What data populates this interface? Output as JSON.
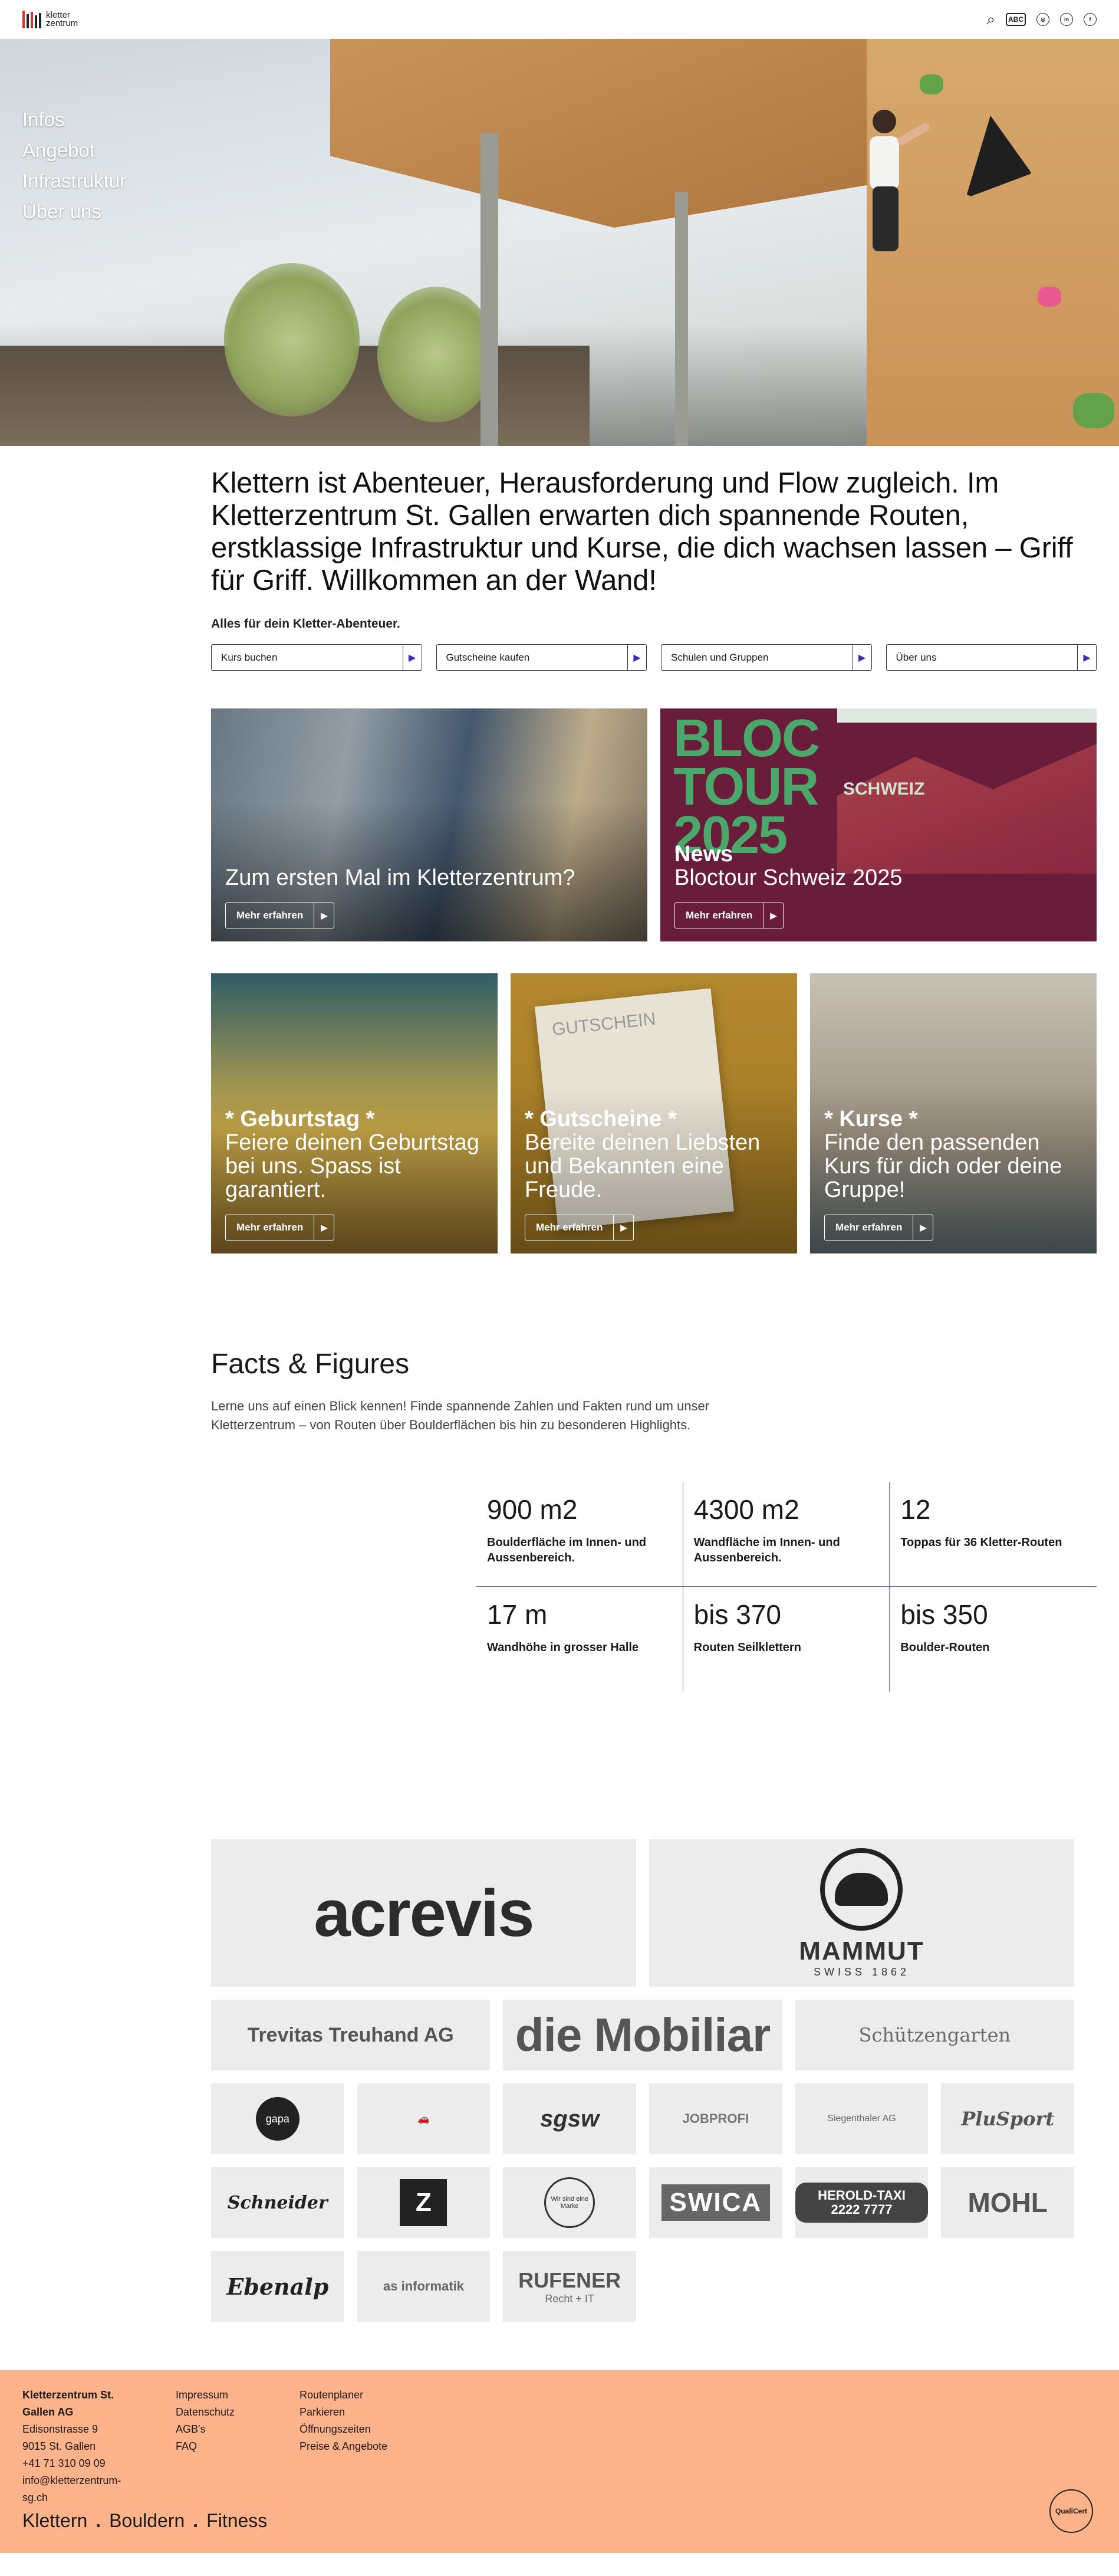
{
  "header": {
    "logo_line1": "kletter",
    "logo_line2": "zentrum",
    "accessibility_label": "ABC",
    "social": [
      "instagram-icon",
      "linkedin-icon",
      "facebook-icon"
    ]
  },
  "hero_nav": [
    "Infos",
    "Angebot",
    "Infrastruktur",
    "Über uns"
  ],
  "intro": {
    "headline": "Klettern ist Abenteuer, Herausforderung und Flow zugleich. Im Kletterzentrum St. Gallen erwarten dich spannende Routen, erstklassige Infrastruktur und Kurse, die dich wachsen lassen – Griff für Griff. Willkommen an der Wand!",
    "subtitle": "Alles für dein Kletter-Abenteuer.",
    "buttons": [
      "Kurs buchen",
      "Gutscheine kaufen",
      "Schulen und Gruppen",
      "Über uns"
    ]
  },
  "teasers_top": [
    {
      "kicker": "",
      "title": "Zum ersten Mal im Kletterzentrum?",
      "button": "Mehr erfahren"
    },
    {
      "kicker": "News",
      "title": "Bloctour Schweiz 2025",
      "button": "Mehr erfahren",
      "bg_text": "BLOC TOUR 2025",
      "bg_sub": "SCHWEIZ"
    }
  ],
  "teasers_bottom": [
    {
      "kicker": "* Geburtstag *",
      "text": "Feiere deinen Geburtstag bei uns. Spass ist garantiert.",
      "button": "Mehr erfahren"
    },
    {
      "kicker": "* Gutscheine *",
      "text": "Bereite deinen Liebsten und Bekannten eine Freude.",
      "button": "Mehr erfahren",
      "bg_text": "GUTSCHEIN"
    },
    {
      "kicker": "* Kurse *",
      "text": "Finde den passenden Kurs für dich oder deine Gruppe!",
      "button": "Mehr erfahren"
    }
  ],
  "facts": {
    "title": "Facts & Figures",
    "intro": "Lerne uns auf einen Blick kennen! Finde spannende Zahlen und Fakten rund um unser Kletterzentrum – von Routen über Boulderflächen bis hin zu besonderen Highlights.",
    "items": [
      {
        "value": "900 m2",
        "label": "Boulderfläche im Innen- und Aussenbereich."
      },
      {
        "value": "4300 m2",
        "label": "Wandfläche im Innen- und Aussenbereich."
      },
      {
        "value": "12",
        "label": "Toppas für 36 Kletter-Routen"
      },
      {
        "value": "17 m",
        "label": "Wandhöhe in grosser Halle"
      },
      {
        "value": "bis 370",
        "label": "Routen Seilklettern"
      },
      {
        "value": "bis 350",
        "label": "Boulder-Routen"
      }
    ]
  },
  "sponsors": {
    "acrevis": "acrevis",
    "mammut": "MAMMUT",
    "mammut_sub": "SWISS 1862",
    "trevitas": "Trevitas Treuhand AG",
    "mobiliar": "die Mobiliar",
    "schuetzengarten": "Schützengarten",
    "gapa": "gapa",
    "swica": "SWICA",
    "sgsw": "sgsw",
    "jobprofi": "JOBPROFI",
    "siegenthaler": "Siegenthaler AG",
    "plusport": "PluSport",
    "schneider": "Schneider",
    "z_logo": "Z",
    "taxi": "HEROLD-TAXI 2222 7777",
    "mohl": "MOHL",
    "ebenalp": "Ebenalp",
    "asinformatik": "as informatik",
    "rufener": "RUFENER",
    "rufener_sub": "Recht + IT",
    "seal_text": "Wir sind eine Marke"
  },
  "footer": {
    "company": "Kletterzentrum St. Gallen AG",
    "street": "Edisonstrasse 9",
    "city": "9015 St. Gallen",
    "phone": "+41 71 310 09 09",
    "email": "info@kletterzentrum-sg.ch",
    "links1": [
      "Impressum",
      "Datenschutz",
      "AGB's",
      "FAQ"
    ],
    "links2": [
      "Routenplaner",
      "Parkieren",
      "Öffnungszeiten",
      "Preise & Angebote"
    ],
    "tags": [
      "Klettern",
      "Bouldern",
      "Fitness"
    ],
    "badge": "QualiCert"
  }
}
